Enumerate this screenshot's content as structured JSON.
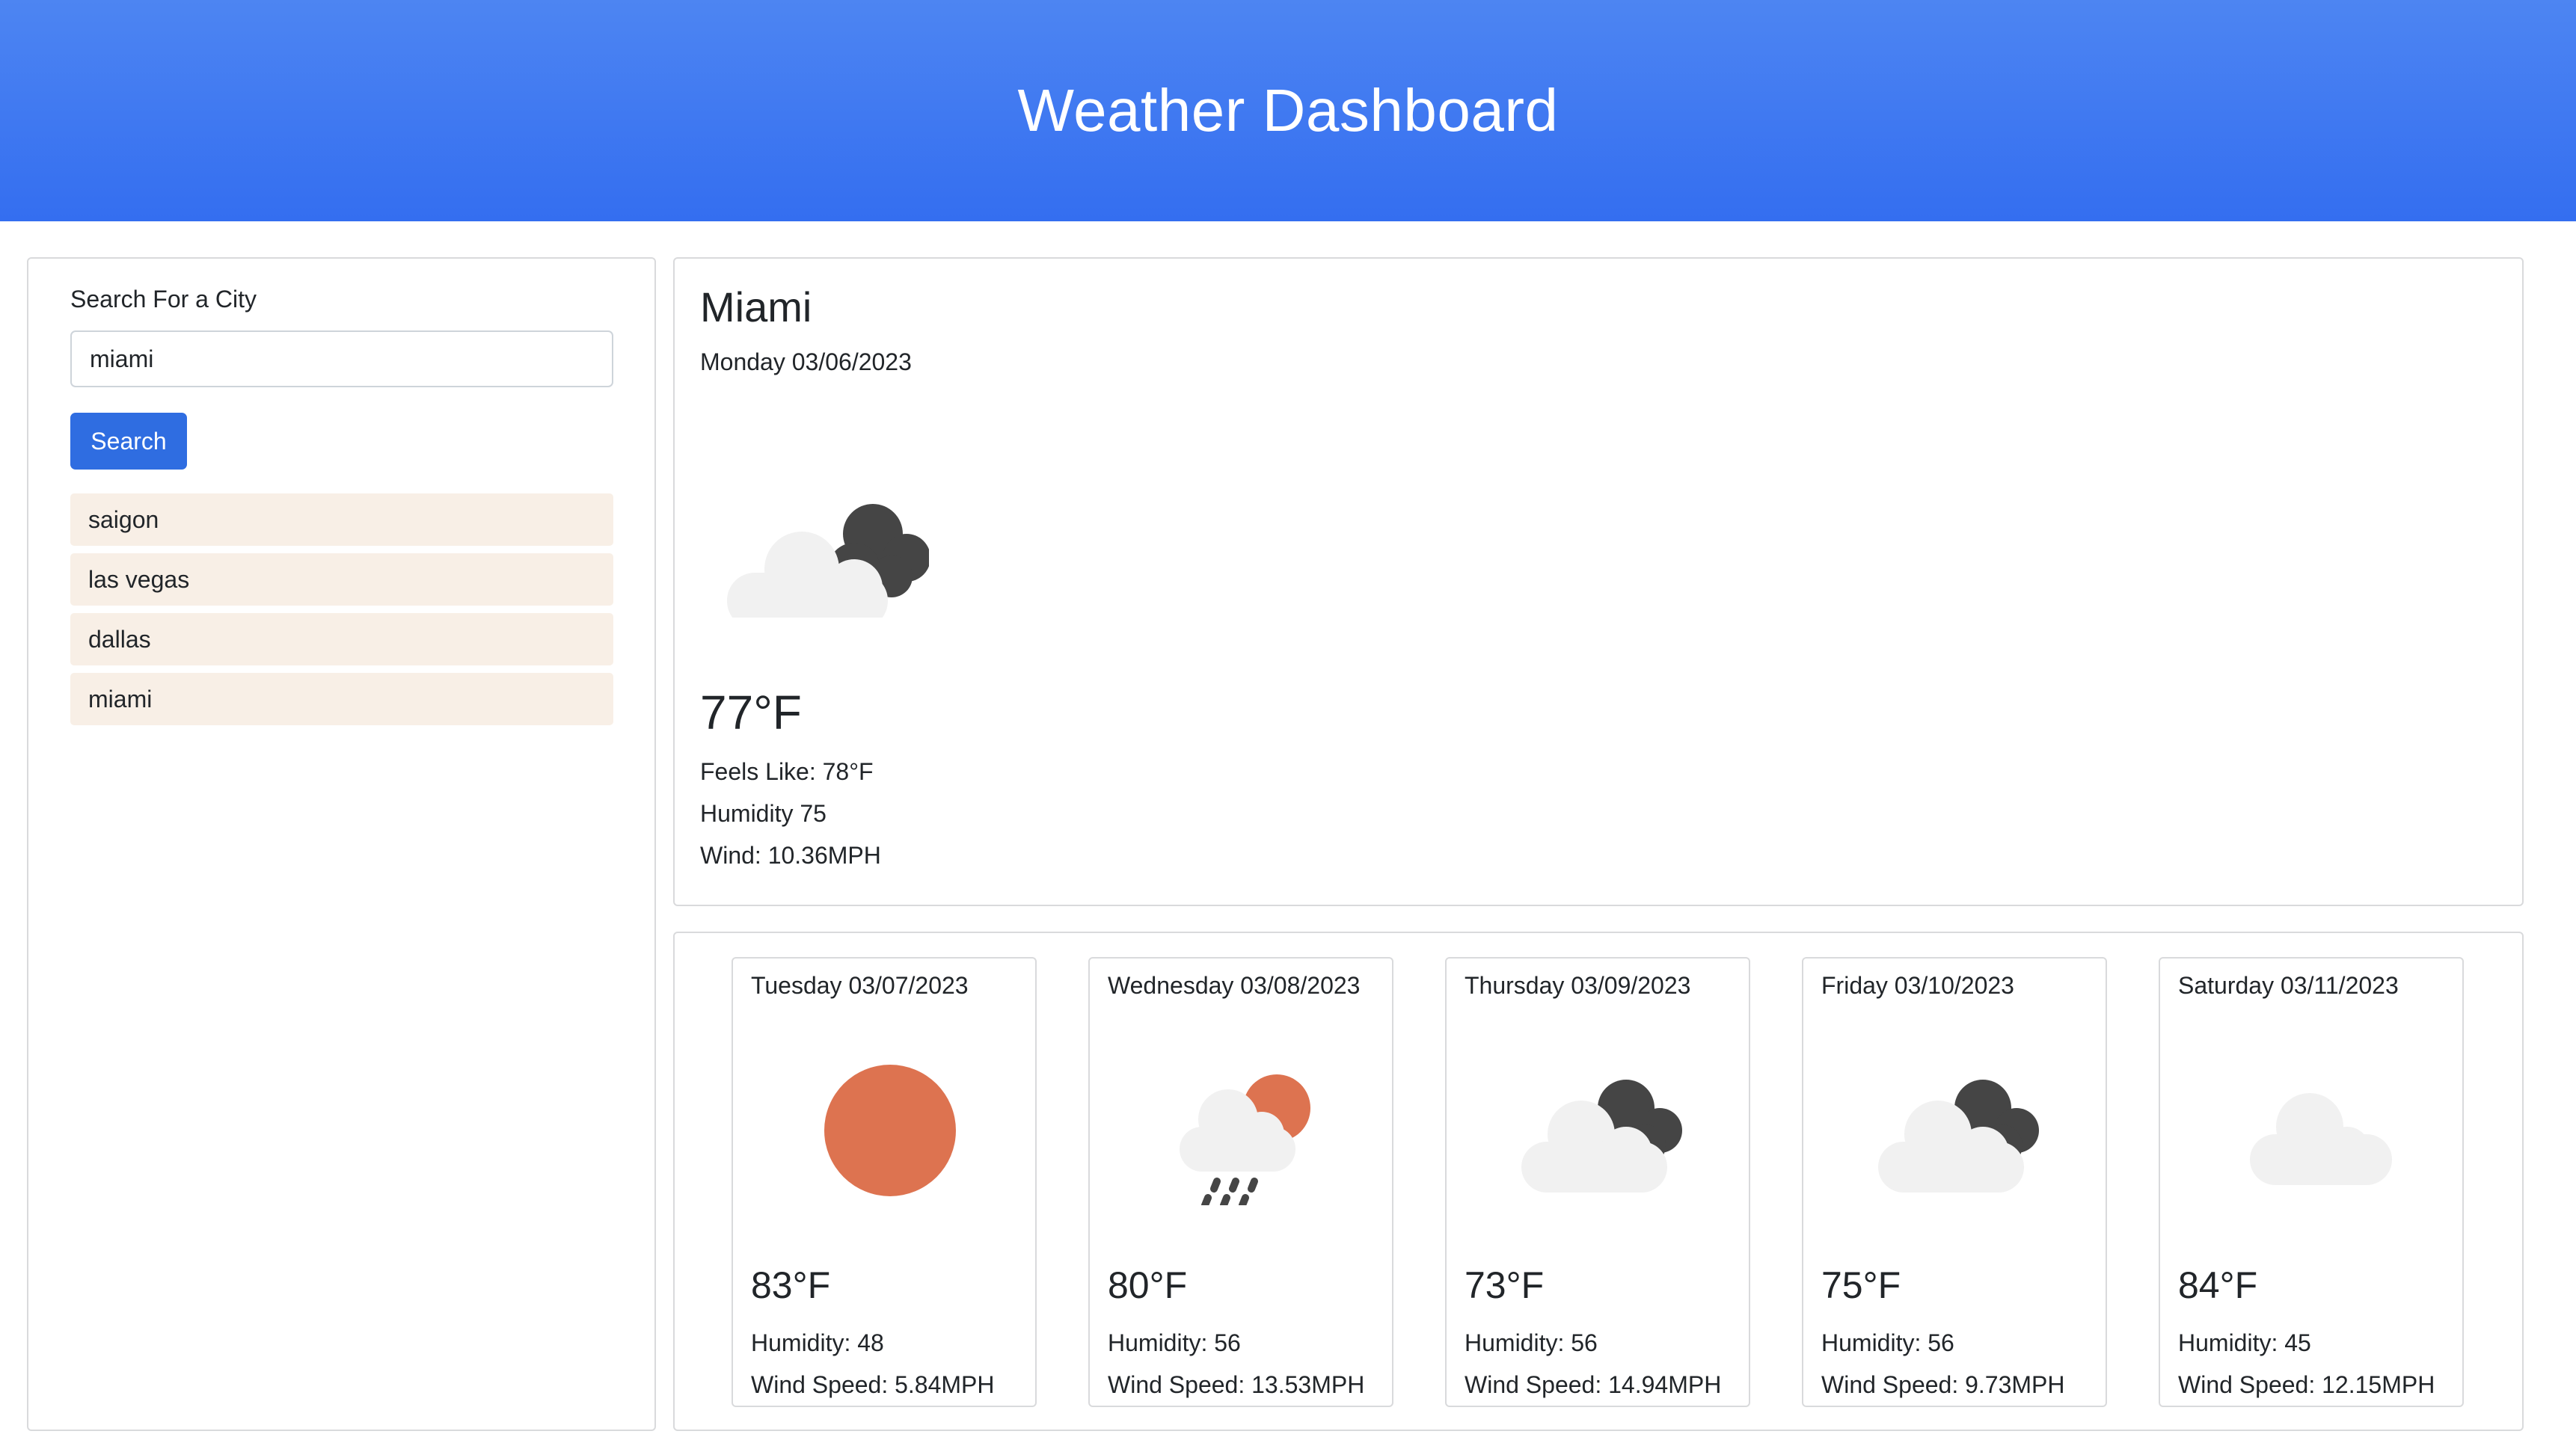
{
  "header": {
    "title": "Weather Dashboard"
  },
  "search": {
    "label": "Search For a City",
    "value": "miami",
    "button_label": "Search",
    "history": [
      "saigon",
      "las vegas",
      "dallas",
      "miami"
    ]
  },
  "current": {
    "city": "Miami",
    "date": "Monday 03/06/2023",
    "icon": "partly-cloudy-dark-cloud-icon",
    "temp": "77°F",
    "feels_like": "Feels Like: 78°F",
    "humidity": "Humidity 75",
    "wind": "Wind: 10.36MPH"
  },
  "forecast": [
    {
      "date": "Tuesday 03/07/2023",
      "icon": "sun-icon",
      "temp": "83°F",
      "humidity": "Humidity: 48",
      "wind": "Wind Speed: 5.84MPH"
    },
    {
      "date": "Wednesday 03/08/2023",
      "icon": "rain-sun-icon",
      "temp": "80°F",
      "humidity": "Humidity: 56",
      "wind": "Wind Speed: 13.53MPH"
    },
    {
      "date": "Thursday 03/09/2023",
      "icon": "broken-clouds-icon",
      "temp": "73°F",
      "humidity": "Humidity: 56",
      "wind": "Wind Speed: 14.94MPH"
    },
    {
      "date": "Friday 03/10/2023",
      "icon": "broken-clouds-icon",
      "temp": "75°F",
      "humidity": "Humidity: 56",
      "wind": "Wind Speed: 9.73MPH"
    },
    {
      "date": "Saturday 03/11/2023",
      "icon": "cloud-icon",
      "temp": "84°F",
      "humidity": "Humidity: 45",
      "wind": "Wind Speed: 12.15MPH"
    }
  ],
  "colors": {
    "header_top": "#4d85f2",
    "header_bottom": "#346ef0",
    "button": "#2f6de1",
    "history_bg": "#f8efe6",
    "sun": "#dd7350",
    "cloud_light": "#f1f1f1",
    "cloud_dark": "#454545"
  }
}
